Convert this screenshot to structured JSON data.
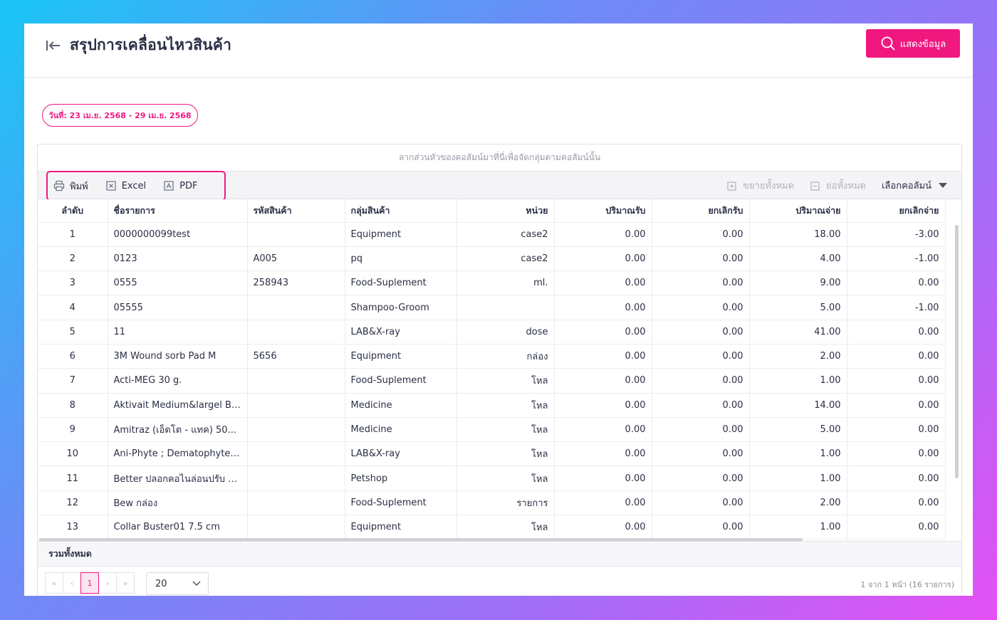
{
  "header": {
    "title": "สรุปการเคลื่อนไหวสินค้า",
    "show_button_label": "แสดงข้อมูล"
  },
  "filter": {
    "date_range": "วันที่: 23 เม.ย. 2568 - 29 เม.ย. 2568"
  },
  "grid": {
    "group_panel_hint": "ลากส่วนหัวของคอลัมน์มาที่นี่เพื่อจัดกลุ่มตามคอลัมน์นั้น",
    "toolbar": {
      "print_label": "พิมพ์",
      "excel_label": "Excel",
      "pdf_label": "PDF",
      "expand_all_label": "ขยายทั้งหมด",
      "collapse_all_label": "ย่อทั้งหมด",
      "column_chooser_label": "เลือกคอลัมน์"
    },
    "columns": [
      "ลำดับ",
      "ชื่อรายการ",
      "รหัสสินค้า",
      "กลุ่มสินค้า",
      "หน่วย",
      "ปริมาณรับ",
      "ยกเลิกรับ",
      "ปริมาณจ่าย",
      "ยกเลิกจ่าย"
    ],
    "rows": [
      [
        "1",
        "0000000099test",
        "",
        "Equipment",
        "case2",
        "0.00",
        "0.00",
        "18.00",
        "-3.00"
      ],
      [
        "2",
        "0123",
        "A005",
        "pq",
        "case2",
        "0.00",
        "0.00",
        "4.00",
        "-1.00"
      ],
      [
        "3",
        "0555",
        "258943",
        "Food-Suplement",
        "ml.",
        "0.00",
        "0.00",
        "9.00",
        "0.00"
      ],
      [
        "4",
        "05555",
        "",
        "Shampoo-Groom",
        "",
        "0.00",
        "0.00",
        "5.00",
        "-1.00"
      ],
      [
        "5",
        "11",
        "",
        "LAB&X-ray",
        "dose",
        "0.00",
        "0.00",
        "41.00",
        "0.00"
      ],
      [
        "6",
        "3M Wound sorb Pad M",
        "5656",
        "Equipment",
        "กล่อง",
        "0.00",
        "0.00",
        "2.00",
        "0.00"
      ],
      [
        "7",
        "Acti-MEG 30 g.",
        "",
        "Food-Suplement",
        "โหล",
        "0.00",
        "0.00",
        "1.00",
        "0.00"
      ],
      [
        "8",
        "Aktivait Medium&largel Br...",
        "",
        "Medicine",
        "โหล",
        "0.00",
        "0.00",
        "14.00",
        "0.00"
      ],
      [
        "9",
        "Amitraz (เอ็ดโต - แทค) 50...",
        "",
        "Medicine",
        "โหล",
        "0.00",
        "0.00",
        "5.00",
        "0.00"
      ],
      [
        "10",
        "Ani-Phyte ; Dematophyte ...",
        "",
        "LAB&X-ray",
        "โหล",
        "0.00",
        "0.00",
        "1.00",
        "0.00"
      ],
      [
        "11",
        "Better ปลอกคอไนล่อนปรับ 1...",
        "",
        "Petshop",
        "โหล",
        "0.00",
        "0.00",
        "1.00",
        "0.00"
      ],
      [
        "12",
        "Bew กล่อง",
        "",
        "Food-Suplement",
        "รายการ",
        "0.00",
        "0.00",
        "2.00",
        "0.00"
      ],
      [
        "13",
        "Collar Buster01 7.5 cm",
        "",
        "Equipment",
        "โหล",
        "0.00",
        "0.00",
        "1.00",
        "0.00"
      ]
    ],
    "summary_label": "รวมทั้งหมด",
    "pagination": {
      "first": "«",
      "prev": "‹",
      "current_page": "1",
      "next": "›",
      "last": "»",
      "page_size": "20",
      "info": "1 จาก 1 หน้า (16 รายการ)"
    }
  },
  "colors": {
    "accent": "#f0187f",
    "text": "#2b2f45"
  }
}
